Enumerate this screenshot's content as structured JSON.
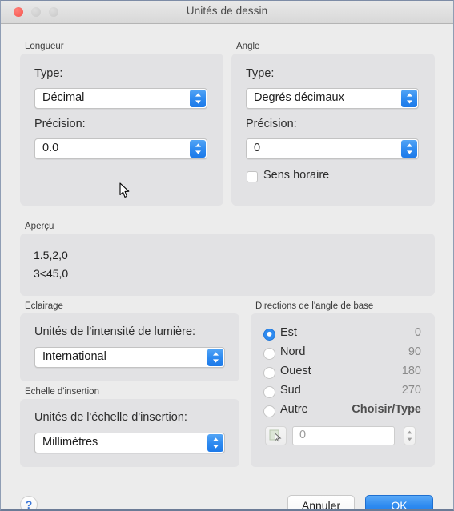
{
  "window": {
    "title": "Unités de dessin",
    "traffic_lights": [
      "close-button",
      "minimize-button",
      "zoom-button"
    ]
  },
  "length": {
    "group_label": "Longueur",
    "type_label": "Type:",
    "type_value": "Décimal",
    "precision_label": "Précision:",
    "precision_value": "0.0"
  },
  "angle": {
    "group_label": "Angle",
    "type_label": "Type:",
    "type_value": "Degrés décimaux",
    "precision_label": "Précision:",
    "precision_value": "0",
    "clockwise_label": "Sens horaire",
    "clockwise_checked": false
  },
  "preview": {
    "group_label": "Aperçu",
    "line1": "1.5,2,0",
    "line2": "3<45,0"
  },
  "lighting": {
    "group_label": "Eclairage",
    "units_label": "Unités de l'intensité de lumière:",
    "units_value": "International"
  },
  "insertion_scale": {
    "group_label": "Echelle d'insertion",
    "units_label": "Unités de l'échelle d'insertion:",
    "units_value": "Millimètres"
  },
  "base_angle": {
    "group_label": "Directions de l'angle de base",
    "options": [
      {
        "label": "Est",
        "value": "0",
        "selected": true
      },
      {
        "label": "Nord",
        "value": "90",
        "selected": false
      },
      {
        "label": "Ouest",
        "value": "180",
        "selected": false
      },
      {
        "label": "Sud",
        "value": "270",
        "selected": false
      },
      {
        "label": "Autre",
        "value": "Choisir/Type",
        "selected": false
      }
    ],
    "angle_field_value": "0"
  },
  "footer": {
    "help_label": "?",
    "cancel_label": "Annuler",
    "ok_label": "OK"
  },
  "colors": {
    "accent": "#2f8bf0",
    "window_bg": "#ececec",
    "group_bg": "#e2e2e4",
    "close_light": "#f8615a"
  }
}
